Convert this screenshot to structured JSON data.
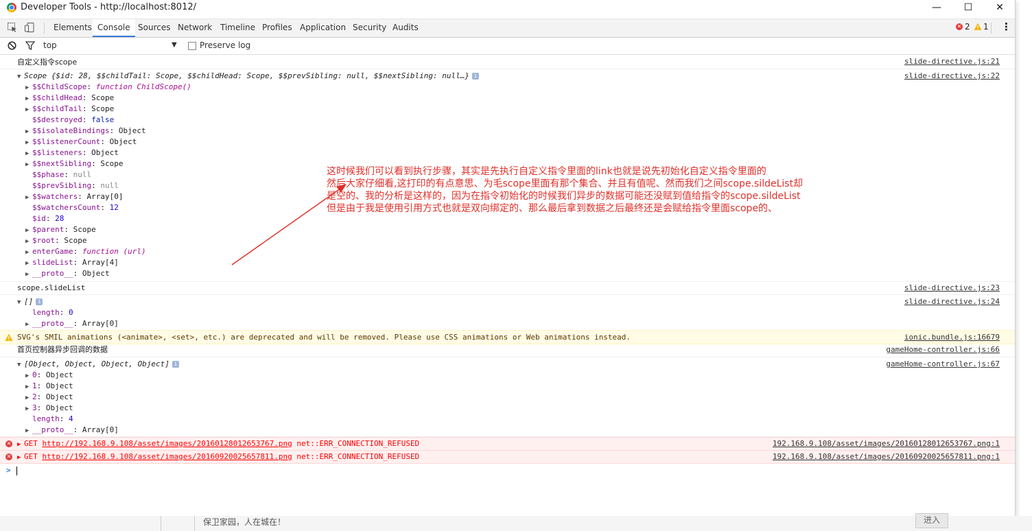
{
  "window": {
    "title": "Developer Tools - http://localhost:8012/",
    "minimize": "—",
    "maximize": "☐",
    "close": "✕"
  },
  "toolbar": {
    "tabs": [
      "Elements",
      "Console",
      "Sources",
      "Network",
      "Timeline",
      "Profiles",
      "Application",
      "Security",
      "Audits"
    ],
    "active_tab": "Console",
    "error_count": "2",
    "warning_count": "1",
    "menu": "⋮"
  },
  "filter": {
    "context": "top",
    "dropdown": "▼",
    "preserve_log": "Preserve log"
  },
  "console": {
    "lines": [
      {
        "text": "自定义指令scope",
        "src": "slide-directive.js:21"
      },
      {
        "text": "Scope {$id: 28, $$childTail: Scope, $$childHead: Scope, $$prevSibling: null, $$nextSibling: null…}",
        "src": "slide-directive.js:22"
      },
      {
        "key": "$$ChildScope",
        "val": "function ChildScope()"
      },
      {
        "key": "$$childHead",
        "val": "Scope"
      },
      {
        "key": "$$childTail",
        "val": "Scope"
      },
      {
        "key": "$$destroyed",
        "val": "false"
      },
      {
        "key": "$$isolateBindings",
        "val": "Object"
      },
      {
        "key": "$$listenerCount",
        "val": "Object"
      },
      {
        "key": "$$listeners",
        "val": "Object"
      },
      {
        "key": "$$nextSibling",
        "val": "Scope"
      },
      {
        "key": "$$phase",
        "val": "null"
      },
      {
        "key": "$$prevSibling",
        "val": "null"
      },
      {
        "key": "$$watchers",
        "val": "Array[0]"
      },
      {
        "key": "$$watchersCount",
        "val": "12"
      },
      {
        "key": "$id",
        "val": "28"
      },
      {
        "key": "$parent",
        "val": "Scope"
      },
      {
        "key": "$root",
        "val": "Scope"
      },
      {
        "key": "enterGame",
        "val": "function (url)"
      },
      {
        "key": "slideList",
        "val": "Array[4]"
      },
      {
        "key": "__proto__",
        "val": "Object"
      },
      {
        "text": "scope.slideList",
        "src": "slide-directive.js:23"
      },
      {
        "text": "[]",
        "src": "slide-directive.js:24"
      },
      {
        "key": "length",
        "val": "0"
      },
      {
        "key": "__proto__",
        "val": "Array[0]"
      },
      {
        "text": "SVG's SMIL animations (<animate>, <set>, etc.) are deprecated and will be removed. Please use CSS animations or Web animations instead.",
        "src": "ionic.bundle.js:16679"
      },
      {
        "text": "首页控制器异步回调的数据",
        "src": "gameHome-controller.js:66"
      },
      {
        "text": "[Object, Object, Object, Object]",
        "src": "gameHome-controller.js:67"
      },
      {
        "key": "0",
        "val": "Object"
      },
      {
        "key": "1",
        "val": "Object"
      },
      {
        "key": "2",
        "val": "Object"
      },
      {
        "key": "3",
        "val": "Object"
      },
      {
        "key": "length",
        "val": "4"
      },
      {
        "key": "__proto__",
        "val": "Array[0]"
      },
      {
        "method": "GET",
        "url": "http://192.168.9.108/asset/images/20160128012653767.png",
        "err": "net::ERR_CONNECTION_REFUSED",
        "src": "192.168.9.108/asset/images/20160128012653767.png:1"
      },
      {
        "method": "GET",
        "url": "http://192.168.9.108/asset/images/20160920025657811.png",
        "err": "net::ERR_CONNECTION_REFUSED",
        "src": "192.168.9.108/asset/images/20160920025657811.png:1"
      }
    ],
    "prompt": ">"
  },
  "annotation": {
    "lines": [
      "这时候我们可以看到执行步骤，其实是先执行自定义指令里面的link也就是说先初始化自定义指令里面的",
      "然后大家仔细看,这打印的有点意思、为毛scope里面有那个集合、并且有值呢、然而我们之间scope.sildeList却",
      "是空的、我的分析是这样的，因为在指令初始化的时候我们异步的数据可能还没赋到值给指令的scope.sildeList",
      "但是由于我是使用引用方式也就是双向绑定的、那么最后拿到数据之后最终还是会赋给指令里面scope的、"
    ],
    "color": "#e0302a"
  },
  "background_page": {
    "text": "保卫家园，人在城在！",
    "button": "进入"
  }
}
